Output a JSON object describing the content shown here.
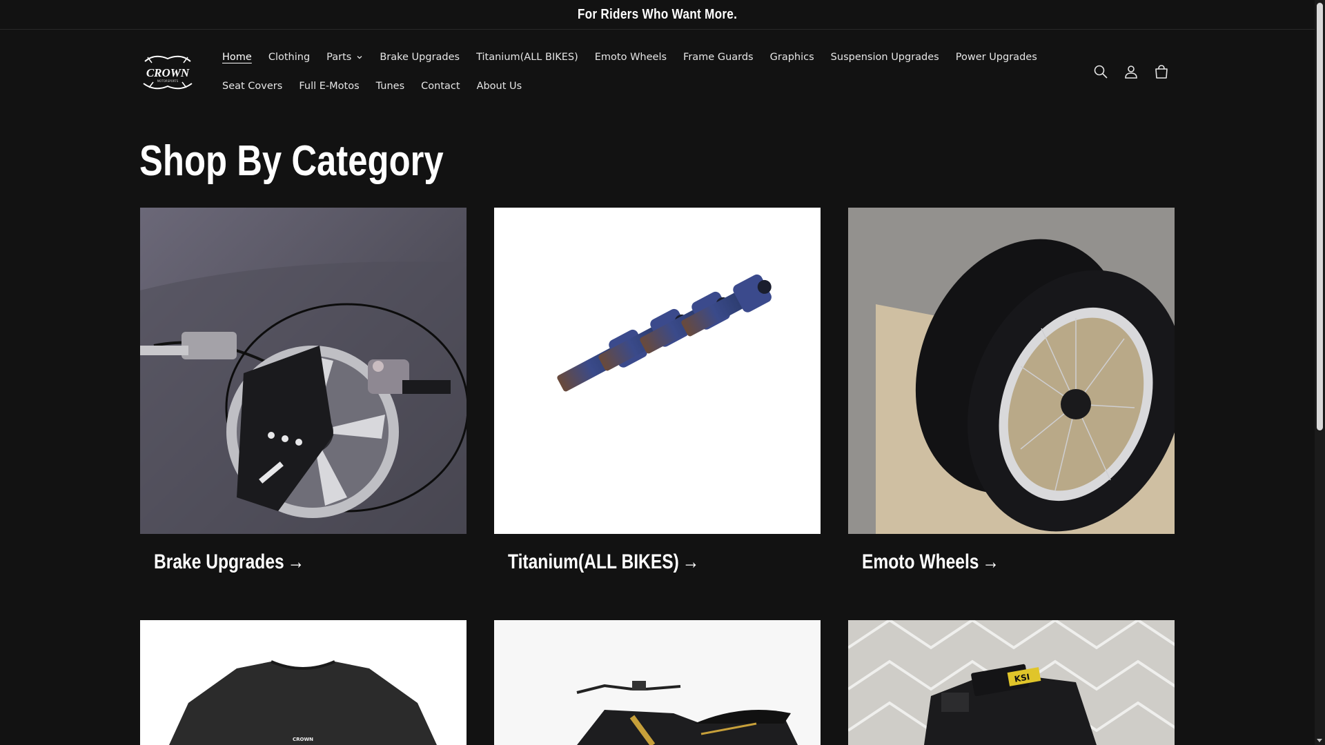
{
  "announcement": {
    "text": "For Riders Who Want More."
  },
  "logo": {
    "text": "CROWN",
    "subtext": "MOTORSPORTS"
  },
  "nav": {
    "row1": [
      {
        "label": "Home",
        "active": true
      },
      {
        "label": "Clothing"
      },
      {
        "label": "Parts",
        "has_dropdown": true
      },
      {
        "label": "Brake Upgrades"
      },
      {
        "label": "Titanium(ALL BIKES)"
      },
      {
        "label": "Emoto Wheels"
      },
      {
        "label": "Frame Guards"
      },
      {
        "label": "Graphics"
      },
      {
        "label": "Suspension Upgrades"
      },
      {
        "label": "Power Upgrades"
      }
    ],
    "row2": [
      {
        "label": "Seat Covers"
      },
      {
        "label": "Full E-Motos"
      },
      {
        "label": "Tunes"
      },
      {
        "label": "Contact"
      },
      {
        "label": "About Us"
      }
    ]
  },
  "header_icons": [
    "search-icon",
    "account-icon",
    "cart-icon"
  ],
  "section": {
    "title": "Shop By Category"
  },
  "categories": [
    {
      "label": "Brake Upgrades",
      "image": "brake-kit"
    },
    {
      "label": "Titanium(ALL BIKES)",
      "image": "titanium-bolts"
    },
    {
      "label": "Emoto Wheels",
      "image": "wheels"
    },
    {
      "label": "",
      "image": "t-shirt",
      "image_text": "CROWN"
    },
    {
      "label": "",
      "image": "e-moto"
    },
    {
      "label": "",
      "image": "battery-pack",
      "image_text": "KSI"
    }
  ],
  "colors": {
    "background": "#121212",
    "text": "#ffffff"
  }
}
